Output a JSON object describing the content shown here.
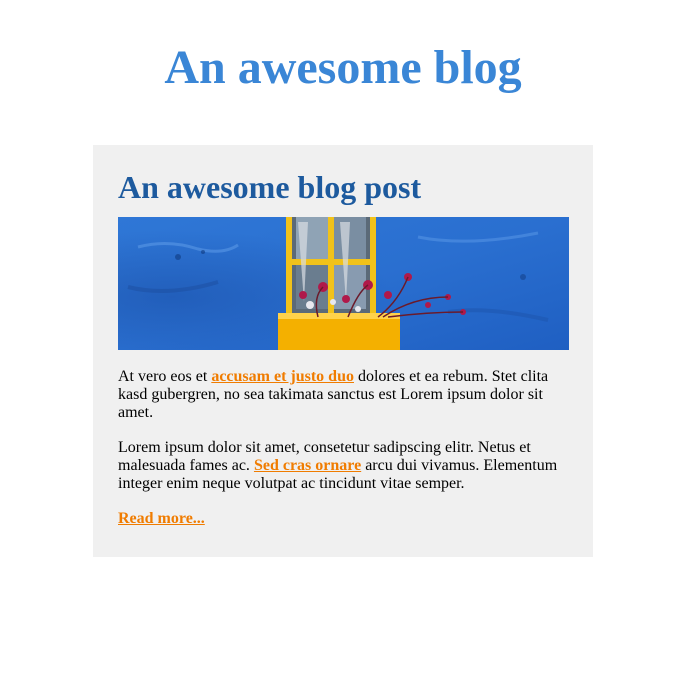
{
  "site": {
    "title": "An awesome blog"
  },
  "post": {
    "title": "An awesome blog post",
    "image_alt": "Blue wall with yellow window and flower box",
    "paragraphs": [
      {
        "before": "At vero eos et ",
        "link": "accusam et justo duo",
        "after": " dolores et ea rebum. Stet clita kasd gubergren, no sea takimata sanctus est Lorem ipsum dolor sit amet."
      },
      {
        "before": "Lorem ipsum dolor sit amet, consetetur sadipscing elitr. Netus et malesuada fames ac. ",
        "link": "Sed cras ornare",
        "after": " arcu dui vivamus. Elementum integer enim neque volutpat ac tincidunt vitae semper."
      }
    ],
    "read_more": "Read more..."
  },
  "colors": {
    "site_title": "#3a86d6",
    "post_title": "#1d5a9e",
    "link": "#f07c00",
    "card_bg": "#f0f0f0"
  }
}
